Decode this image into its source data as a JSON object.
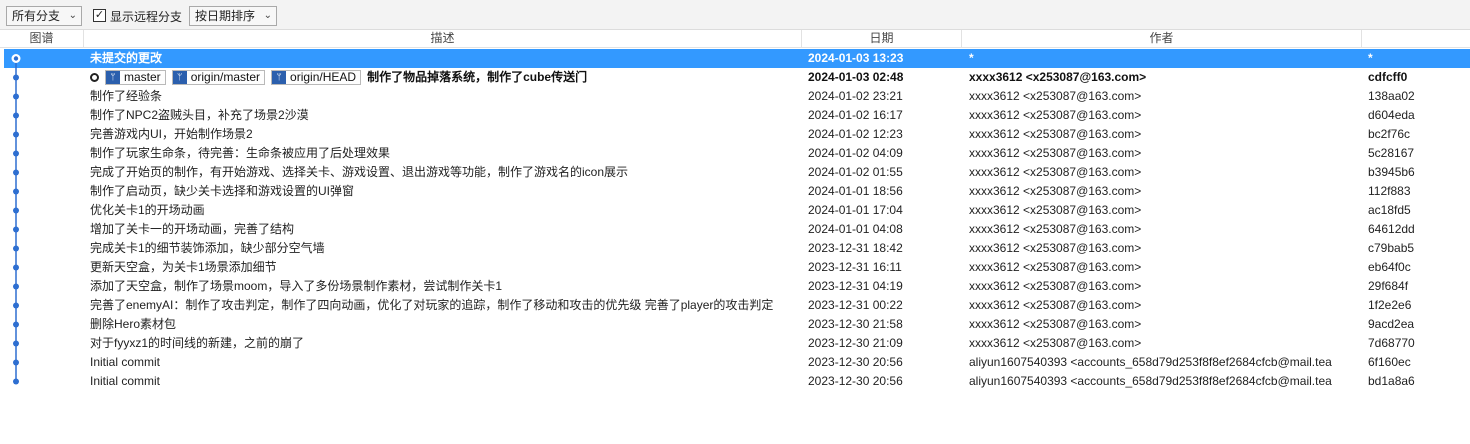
{
  "toolbar": {
    "branch_filter": "所有分支",
    "show_remote_label": "显示远程分支",
    "sort_order": "按日期排序"
  },
  "columns": {
    "graph": "图谱",
    "desc": "描述",
    "date": "日期",
    "author": "作者"
  },
  "colors": {
    "selection": "#3399ff",
    "graph_line": "#2e6fd1",
    "tag_icon": "#2b5fad"
  },
  "icons": {
    "branch_tag": "branch-icon",
    "commit_node": "dot-icon"
  },
  "commits": [
    {
      "desc": "未提交的更改",
      "date": "2024-01-03 13:23",
      "author": "*",
      "hash": "*"
    },
    {
      "desc": "制作了物品掉落系统，制作了cube传送门",
      "date": "2024-01-03 02:48",
      "author": "xxxx3612 <x253087@163.com>",
      "hash": "cdfcff0"
    },
    {
      "desc": "制作了经验条",
      "date": "2024-01-02 23:21",
      "author": "xxxx3612 <x253087@163.com>",
      "hash": "138aa02"
    },
    {
      "desc": "制作了NPC2盗贼头目，补充了场景2沙漠",
      "date": "2024-01-02 16:17",
      "author": "xxxx3612 <x253087@163.com>",
      "hash": "d604eda"
    },
    {
      "desc": "完善游戏内UI，开始制作场景2",
      "date": "2024-01-02 12:23",
      "author": "xxxx3612 <x253087@163.com>",
      "hash": "bc2f76c"
    },
    {
      "desc": "制作了玩家生命条，待完善：生命条被应用了后处理效果",
      "date": "2024-01-02 04:09",
      "author": "xxxx3612 <x253087@163.com>",
      "hash": "5c28167"
    },
    {
      "desc": "完成了开始页的制作，有开始游戏、选择关卡、游戏设置、退出游戏等功能，制作了游戏名的icon展示",
      "date": "2024-01-02 01:55",
      "author": "xxxx3612 <x253087@163.com>",
      "hash": "b3945b6"
    },
    {
      "desc": "制作了启动页，缺少关卡选择和游戏设置的UI弹窗",
      "date": "2024-01-01 18:56",
      "author": "xxxx3612 <x253087@163.com>",
      "hash": "112f883"
    },
    {
      "desc": "优化关卡1的开场动画",
      "date": "2024-01-01 17:04",
      "author": "xxxx3612 <x253087@163.com>",
      "hash": "ac18fd5"
    },
    {
      "desc": "增加了关卡一的开场动画，完善了结构",
      "date": "2024-01-01 04:08",
      "author": "xxxx3612 <x253087@163.com>",
      "hash": "64612dd"
    },
    {
      "desc": "完成关卡1的细节装饰添加，缺少部分空气墙",
      "date": "2023-12-31 18:42",
      "author": "xxxx3612 <x253087@163.com>",
      "hash": "c79bab5"
    },
    {
      "desc": "更新天空盒，为关卡1场景添加细节",
      "date": "2023-12-31 16:11",
      "author": "xxxx3612 <x253087@163.com>",
      "hash": "eb64f0c"
    },
    {
      "desc": "添加了天空盒，制作了场景moom，导入了多份场景制作素材，尝试制作关卡1",
      "date": "2023-12-31 04:19",
      "author": "xxxx3612 <x253087@163.com>",
      "hash": "29f684f"
    },
    {
      "desc": "完善了enemyAI：制作了攻击判定，制作了四向动画，优化了对玩家的追踪，制作了移动和攻击的优先级 完善了player的攻击判定",
      "date": "2023-12-31 00:22",
      "author": "xxxx3612 <x253087@163.com>",
      "hash": "1f2e2e6"
    },
    {
      "desc": "删除Hero素材包",
      "date": "2023-12-30 21:58",
      "author": "xxxx3612 <x253087@163.com>",
      "hash": "9acd2ea"
    },
    {
      "desc": "对于fyyxz1的时间线的新建，之前的崩了",
      "date": "2023-12-30 21:09",
      "author": "xxxx3612 <x253087@163.com>",
      "hash": "7d68770"
    },
    {
      "desc": "Initial commit",
      "date": "2023-12-30 20:56",
      "author": "aliyun1607540393 <accounts_658d79d253f8f8ef2684cfcb@mail.tea",
      "hash": "6f160ec"
    },
    {
      "desc": "Initial commit",
      "date": "2023-12-30 20:56",
      "author": "aliyun1607540393 <accounts_658d79d253f8f8ef2684cfcb@mail.tea",
      "hash": "bd1a8a6"
    }
  ],
  "head_tags": [
    "master",
    "origin/master",
    "origin/HEAD"
  ]
}
